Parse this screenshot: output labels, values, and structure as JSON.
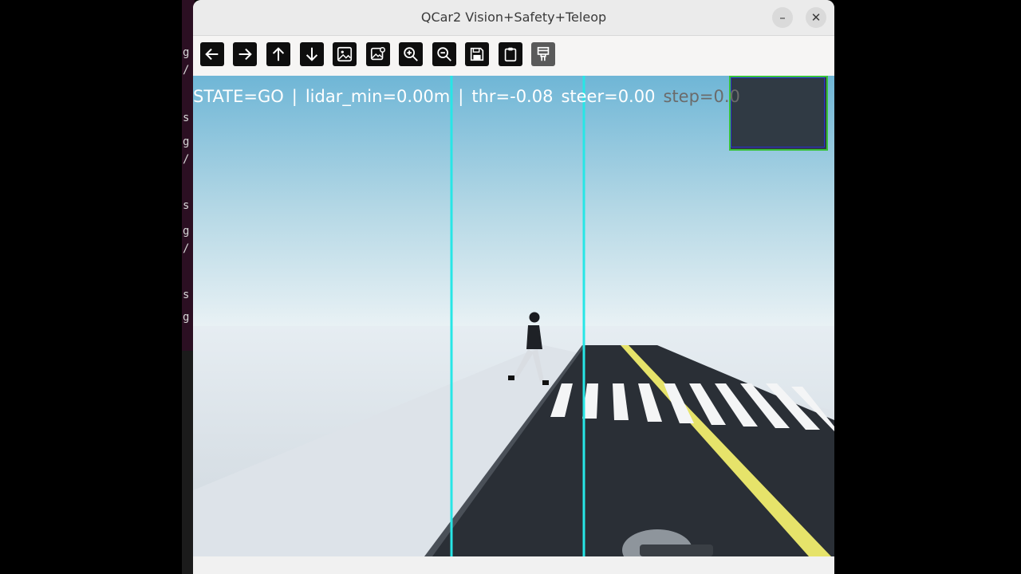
{
  "window": {
    "title": "QCar2 Vision+Safety+Teleop",
    "minimize_glyph": "–",
    "close_glyph": "✕"
  },
  "toolbar": {
    "buttons": [
      {
        "name": "back",
        "icon": "arrow-left-icon"
      },
      {
        "name": "forward",
        "icon": "arrow-right-icon"
      },
      {
        "name": "up",
        "icon": "arrow-up-icon"
      },
      {
        "name": "down",
        "icon": "arrow-down-icon"
      },
      {
        "name": "image",
        "icon": "image-icon"
      },
      {
        "name": "image-settings",
        "icon": "image-settings-icon"
      },
      {
        "name": "zoom-in",
        "icon": "zoom-in-icon"
      },
      {
        "name": "zoom-out",
        "icon": "zoom-out-icon"
      },
      {
        "name": "save",
        "icon": "save-icon"
      },
      {
        "name": "copy-to-clipboard",
        "icon": "clipboard-icon"
      },
      {
        "name": "properties",
        "icon": "properties-icon"
      }
    ]
  },
  "overlay": {
    "state": "STATE=GO",
    "sep1": "|",
    "lidar": "lidar_min=0.00m",
    "sep2": "|",
    "throttle": "thr=-0.08",
    "steer": "steer=0.00",
    "step": "step=0.0"
  },
  "colors": {
    "guide_lines": "#27e6e6",
    "inset_border": "#38c23a",
    "lane_line": "#e6e36a"
  },
  "terminal_fragments": [
    "g",
    "/",
    "s",
    "g",
    "/",
    "s",
    "g",
    "/",
    "s",
    "g"
  ]
}
